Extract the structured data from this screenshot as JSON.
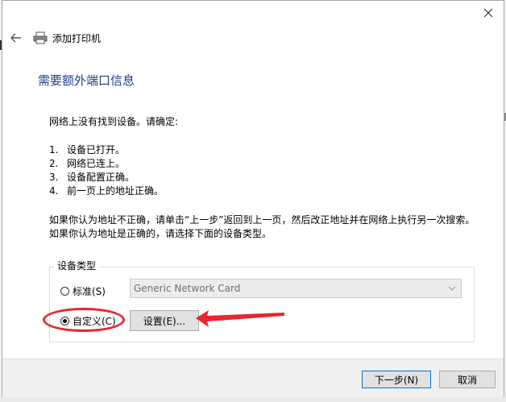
{
  "window": {
    "close_icon": "close-icon",
    "title": "添加打印机"
  },
  "heading": "需要额外端口信息",
  "intro": "网络上没有找到设备。请确定:",
  "checklist": [
    {
      "num": "1.",
      "text": "设备已打开。"
    },
    {
      "num": "2.",
      "text": "网络已连上。"
    },
    {
      "num": "3.",
      "text": "设备配置正确。"
    },
    {
      "num": "4.",
      "text": "前一页上的地址正确。"
    }
  ],
  "advice_line1": "如果你认为地址不正确，请单击“上一步”返回到上一页，然后改正地址并在网络上执行另一次搜索。",
  "advice_line2": "如果你认为地址是正确的，请选择下面的设备类型。",
  "device_type": {
    "legend": "设备类型",
    "standard_label": "标准(S)",
    "standard_value": "Generic Network Card",
    "custom_label": "自定义(C)",
    "selected": "custom",
    "settings_button": "设置(E)..."
  },
  "footer": {
    "next_button": "下一步(N)",
    "cancel_button": "取消"
  },
  "colors": {
    "heading": "#1e3f8a",
    "annotation": "#e8262d",
    "primary_border": "#0078d7"
  }
}
